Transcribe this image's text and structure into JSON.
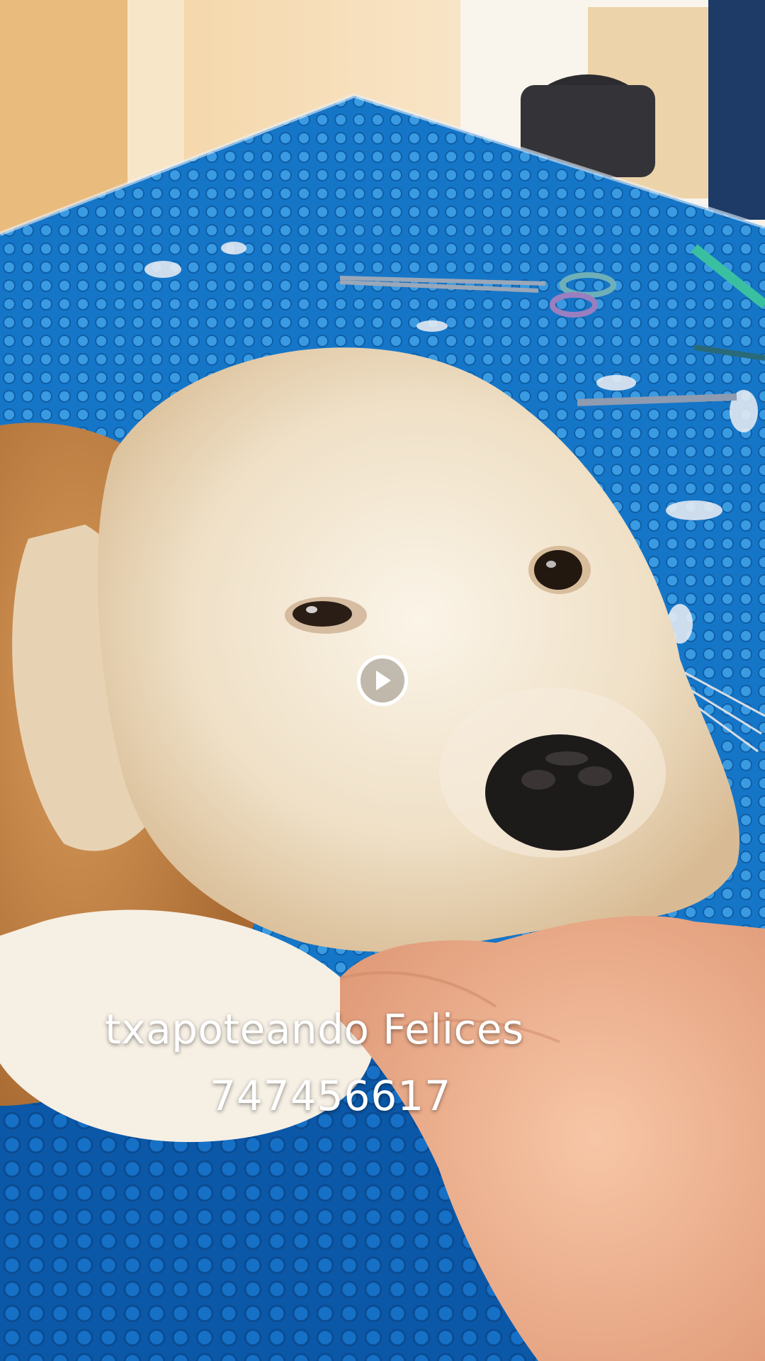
{
  "video": {
    "caption_line_1": "txapoteando Felices",
    "caption_line_2": "747456617",
    "play_icon": "play-icon"
  },
  "colors": {
    "table_blue": "#1a7fd0",
    "caption_text": "#ffffff",
    "fur_cream": "#f1e6d3",
    "fur_tan": "#c9894c"
  }
}
